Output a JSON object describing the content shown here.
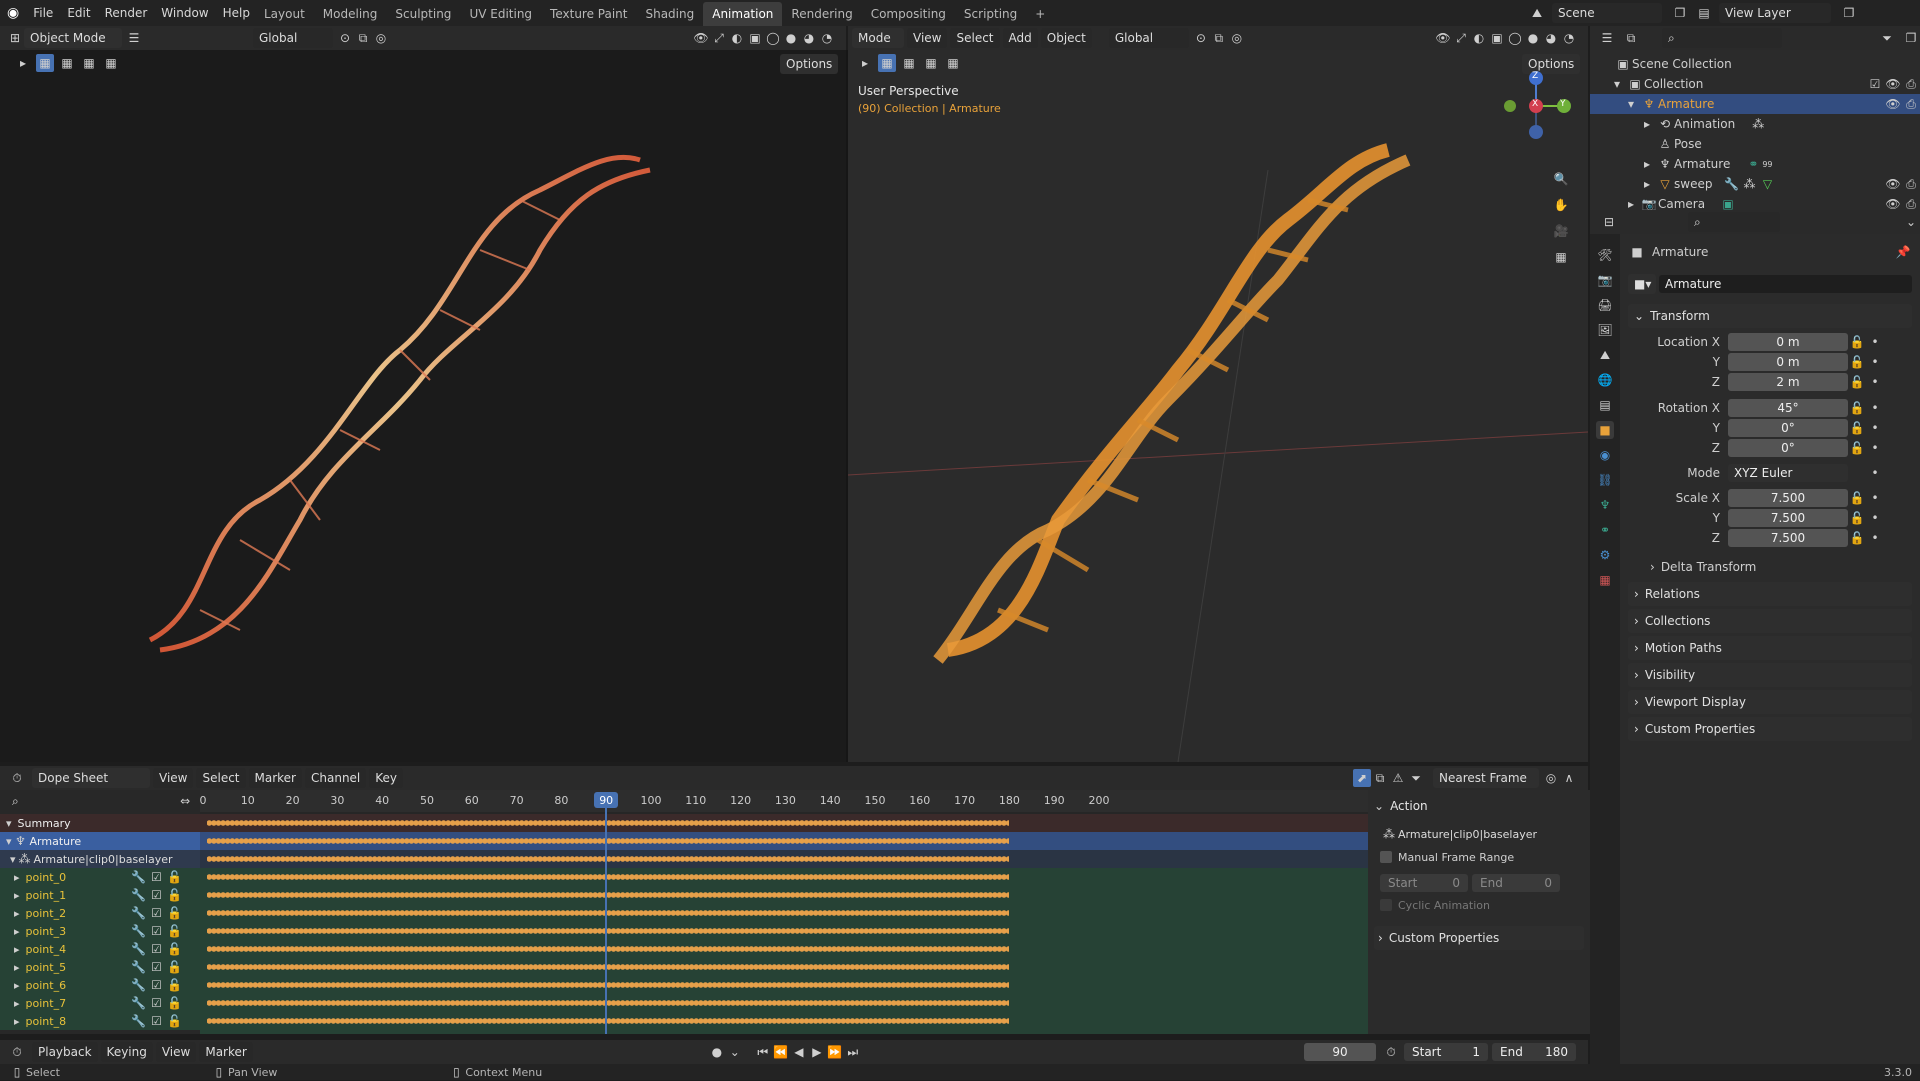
{
  "topbar": {
    "menus": [
      "File",
      "Edit",
      "Render",
      "Window",
      "Help"
    ],
    "workspaces": [
      "Layout",
      "Modeling",
      "Sculpting",
      "UV Editing",
      "Texture Paint",
      "Shading",
      "Animation",
      "Rendering",
      "Compositing",
      "Scripting"
    ],
    "active_workspace": "Animation",
    "scene": "Scene",
    "view_layer": "View Layer"
  },
  "left_viewport": {
    "mode": "Object Mode",
    "orientation": "Global",
    "options": "Options"
  },
  "right_viewport": {
    "mode": "Mode",
    "menus": [
      "View",
      "Select",
      "Add",
      "Object"
    ],
    "orientation": "Global",
    "options": "Options",
    "perspective": "User Perspective",
    "collection_info": "(90) Collection | Armature",
    "gizmo": {
      "x": "X",
      "y": "Y",
      "z": "Z"
    }
  },
  "outliner": {
    "items": [
      {
        "label": "Scene Collection"
      },
      {
        "label": "Collection"
      },
      {
        "label": "Armature"
      },
      {
        "label": "Animation"
      },
      {
        "label": "Pose"
      },
      {
        "label": "Armature"
      },
      {
        "label": "sweep"
      },
      {
        "label": "Camera"
      }
    ],
    "bone_count": "99"
  },
  "properties": {
    "object_name": "Armature",
    "data_name": "Armature",
    "transform_label": "Transform",
    "location": {
      "label": "Location X",
      "x": "0 m",
      "y": "0 m",
      "z": "2 m"
    },
    "rotation": {
      "label": "Rotation X",
      "x": "45°",
      "y": "0°",
      "z": "0°"
    },
    "mode_label": "Mode",
    "mode_value": "XYZ Euler",
    "scale": {
      "label": "Scale X",
      "x": "7.500",
      "y": "7.500",
      "z": "7.500"
    },
    "axis_y": "Y",
    "axis_z": "Z",
    "delta": "Delta Transform",
    "sections": [
      "Relations",
      "Collections",
      "Motion Paths",
      "Visibility",
      "Viewport Display",
      "Custom Properties"
    ]
  },
  "dopesheet": {
    "editor": "Dope Sheet",
    "menus": [
      "View",
      "Select",
      "Marker",
      "Channel",
      "Key"
    ],
    "snap": "Nearest Frame",
    "ruler": [
      "0",
      "10",
      "20",
      "30",
      "40",
      "50",
      "60",
      "70",
      "80",
      "90",
      "100",
      "110",
      "120",
      "130",
      "140",
      "150",
      "160",
      "170",
      "180",
      "190",
      "200"
    ],
    "current_frame": "90",
    "channels": {
      "summary": "Summary",
      "armature": "Armature",
      "action": "Armature|clip0|baselayer",
      "points": [
        "point_0",
        "point_1",
        "point_2",
        "point_3",
        "point_4",
        "point_5",
        "point_6",
        "point_7",
        "point_8"
      ]
    },
    "action_panel": {
      "title": "Action",
      "action_name": "Armature|clip0|baselayer",
      "manual_range": "Manual Frame Range",
      "start_label": "Start",
      "start_value": "0",
      "end_label": "End",
      "end_value": "0",
      "cyclic": "Cyclic Animation",
      "custom": "Custom Properties"
    }
  },
  "timeline": {
    "menus": [
      "Playback",
      "Keying",
      "View",
      "Marker"
    ],
    "frame": "90",
    "start_label": "Start",
    "start": "1",
    "end_label": "End",
    "end": "180"
  },
  "statusbar": {
    "select": "Select",
    "pan": "Pan View",
    "context": "Context Menu",
    "version": "3.3.0"
  }
}
